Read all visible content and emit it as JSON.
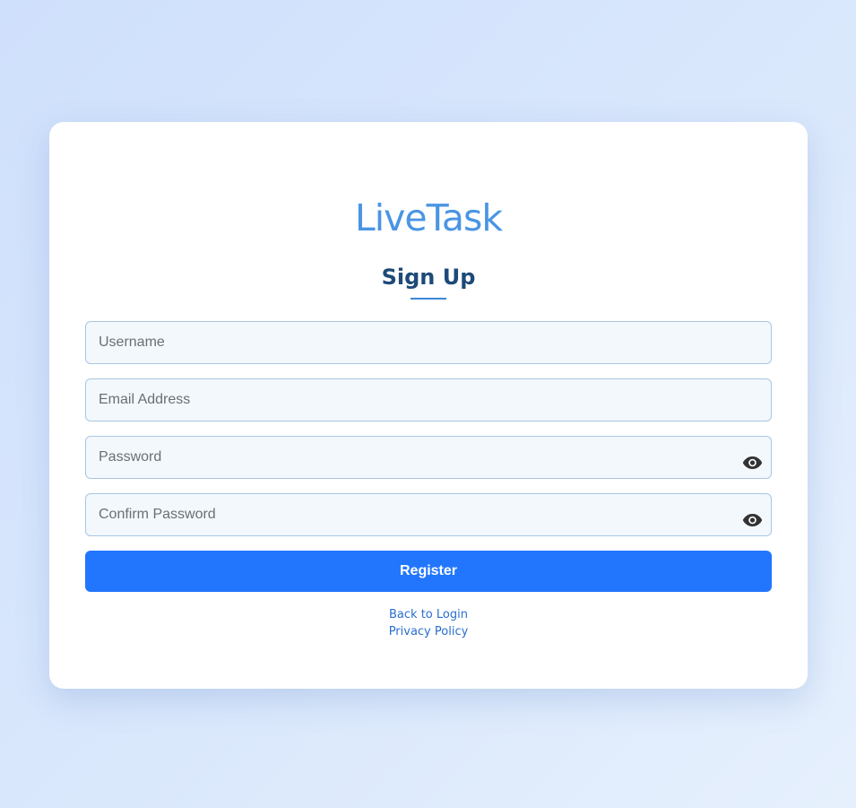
{
  "brand": {
    "name": "LiveTask",
    "color": "#4a95e3"
  },
  "form": {
    "title": "Sign Up",
    "fields": {
      "username": {
        "placeholder": "Username",
        "value": ""
      },
      "email": {
        "placeholder": "Email Address",
        "value": ""
      },
      "password": {
        "placeholder": "Password",
        "value": "",
        "toggle_icon": "eye-icon"
      },
      "confirm_password": {
        "placeholder": "Confirm Password",
        "value": "",
        "toggle_icon": "eye-icon"
      }
    },
    "submit_label": "Register",
    "accent_color": "#2276fe"
  },
  "links": {
    "back_to_login": "Back to Login",
    "privacy_policy": "Privacy Policy"
  }
}
